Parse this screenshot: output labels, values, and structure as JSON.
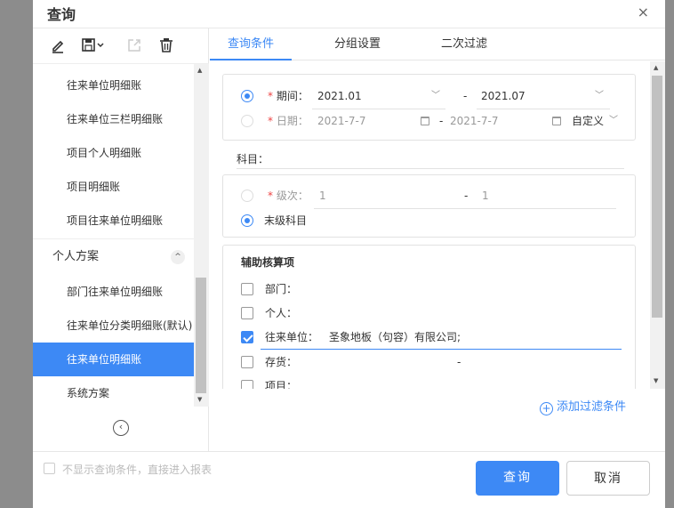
{
  "dialog": {
    "title": "查询",
    "close_symbol": "×"
  },
  "toolbar": {
    "icons": [
      "edit-icon",
      "save-dropdown-icon",
      "export-icon",
      "delete-icon"
    ]
  },
  "sidebar": {
    "items_top": [
      "往来单位明细账",
      "往来单位三栏明细账",
      "项目个人明细账",
      "项目明细账",
      "项目往来单位明细账"
    ],
    "section_title": "个人方案",
    "section_toggle": "^",
    "items_personal": [
      "部门往来单位明细账",
      "往来单位分类明细账(默认)",
      "往来单位明细账",
      "系统方案"
    ],
    "active_item": "往来单位明细账",
    "collapse_symbol": "‹"
  },
  "tabs": [
    "查询条件",
    "分组设置",
    "二次过滤"
  ],
  "active_tab": "查询条件",
  "period": {
    "required_mark": "*",
    "period_label": "期间：",
    "period_from": "2021.01",
    "period_to": "2021.07",
    "range_sep": "-",
    "date_label": "日期：",
    "date_from": "2021-7-7",
    "date_to": "2021-7-7",
    "date_mode": "自定义"
  },
  "subject": {
    "label": "科目：",
    "value": ""
  },
  "level": {
    "required_mark": "*",
    "level_label": "级次：",
    "level_from": "1",
    "level_to": "1",
    "range_sep": "-",
    "last_level_label": "末级科目"
  },
  "auxiliary": {
    "title": "辅助核算项",
    "items": [
      {
        "label": "部门：",
        "value": "",
        "checked": false
      },
      {
        "label": "个人：",
        "value": "",
        "checked": false
      },
      {
        "label": "往来单位：",
        "value": "圣象地板（句容）有限公司;",
        "checked": true
      },
      {
        "label": "存货：",
        "value": "-",
        "checked": false
      },
      {
        "label": "项目：",
        "value": "",
        "checked": false
      }
    ]
  },
  "add_filter": {
    "plus": "+",
    "label": "添加过滤条件"
  },
  "footer": {
    "skip_label": "不显示查询条件，直接进入报表",
    "query_button": "查询",
    "cancel_button": "取消"
  },
  "colors": {
    "accent": "#3d89f5",
    "required": "#e44444",
    "backdrop": "#8c8c8c"
  }
}
